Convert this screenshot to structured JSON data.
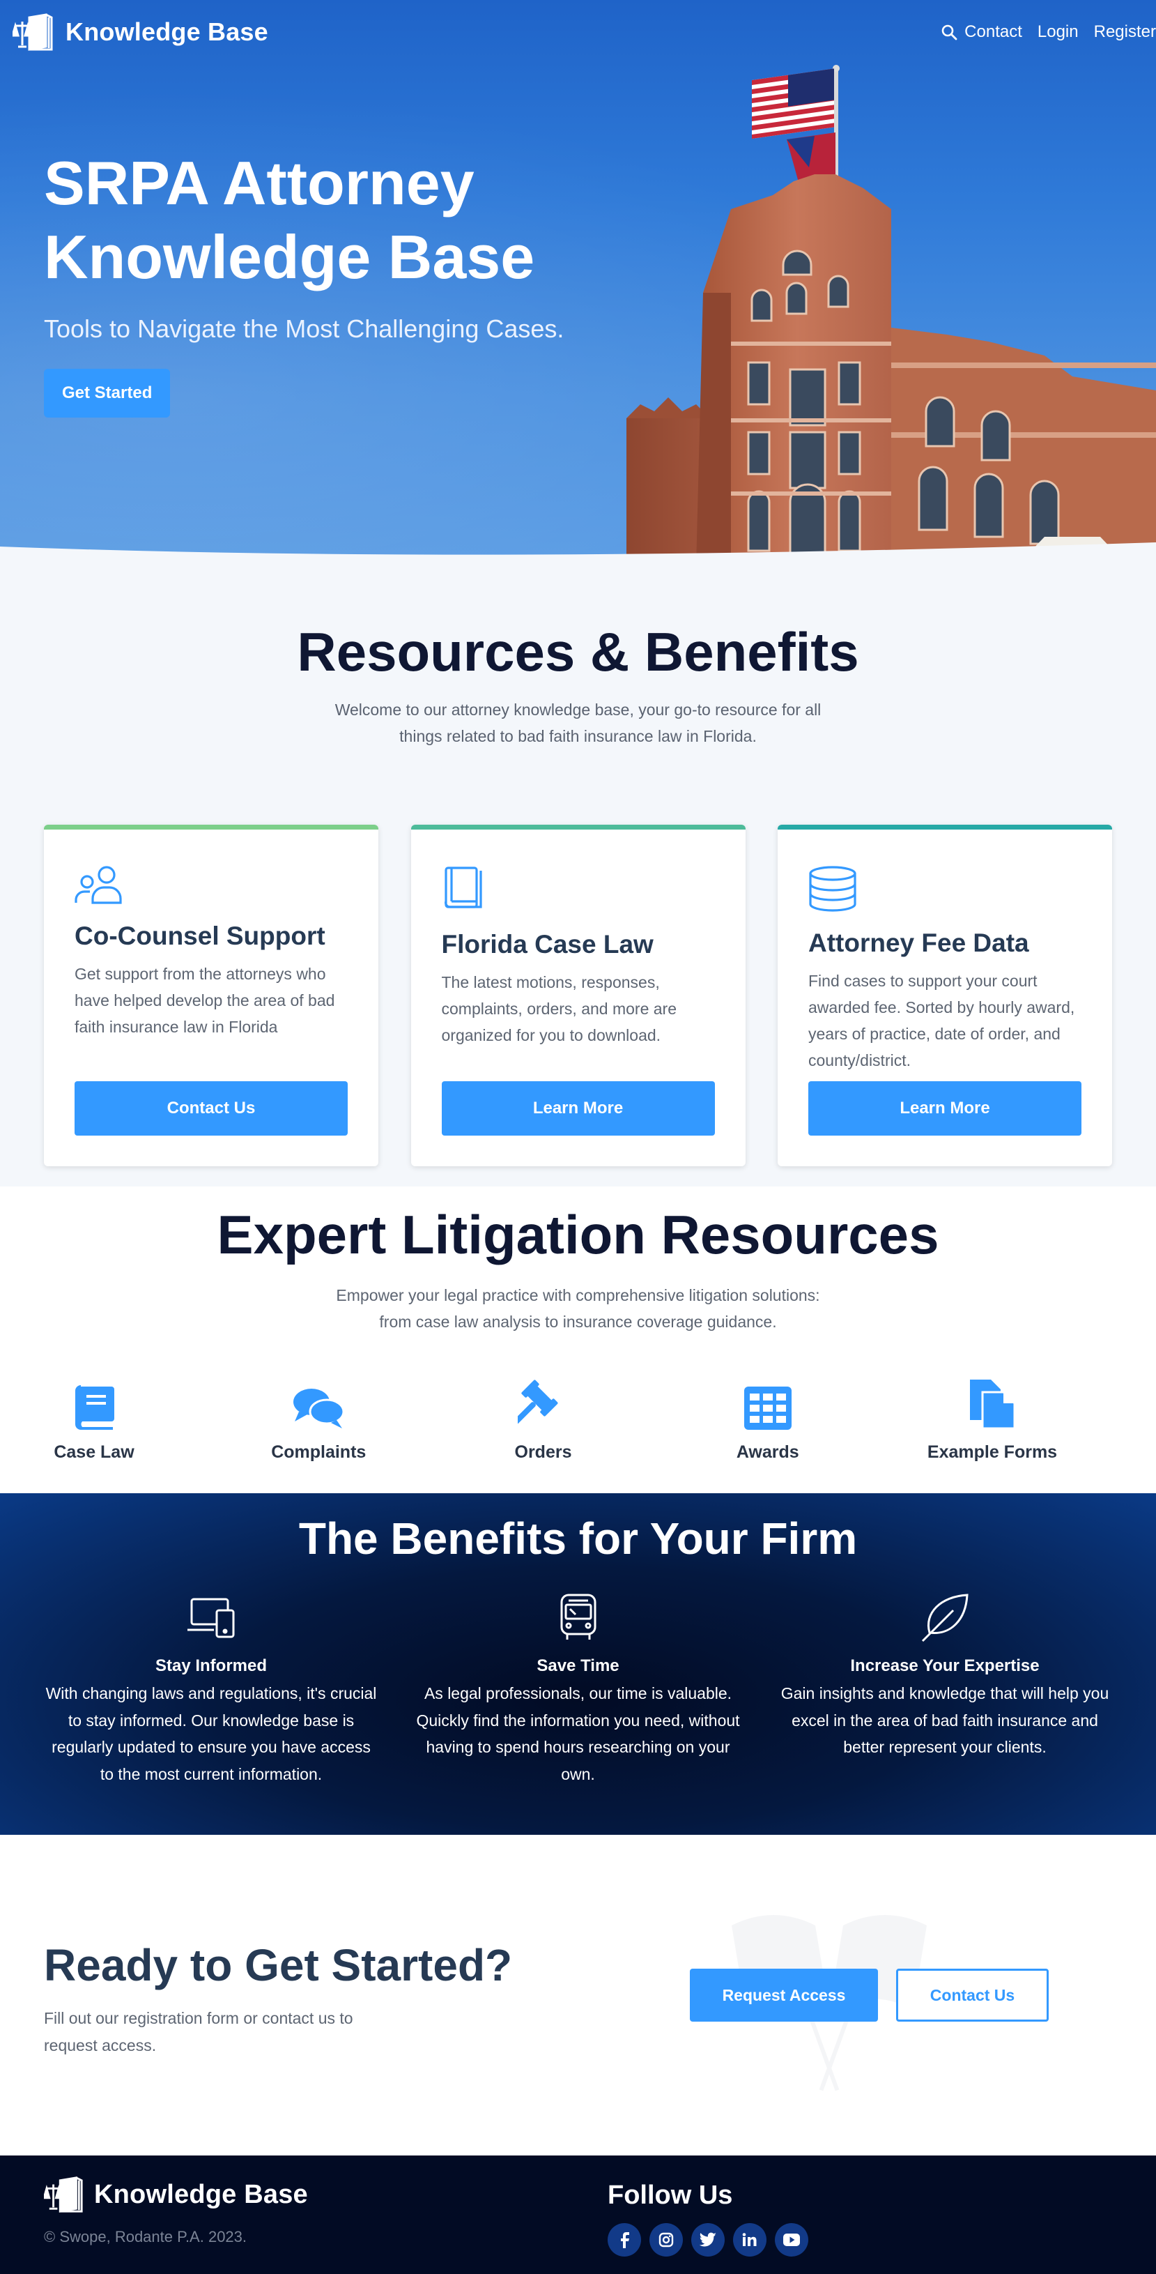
{
  "nav": {
    "brand": "Knowledge Base",
    "links": [
      "Contact",
      "Login",
      "Register"
    ]
  },
  "hero": {
    "title_line1": "SRPA Attorney",
    "title_line2": "Knowledge Base",
    "subtitle": "Tools to Navigate the Most Challenging Cases.",
    "cta": "Get Started"
  },
  "resources": {
    "title": "Resources & Benefits",
    "subtitle": "Welcome to our attorney knowledge base, your go-to resource for all things related to bad faith insurance law in Florida.",
    "cards": [
      {
        "title": "Co-Counsel Support",
        "text": "Get support from the attorneys who have helped develop the area of bad faith insurance law in Florida",
        "button": "Contact Us",
        "icon": "users-icon",
        "bar_color": "#7ccf8a"
      },
      {
        "title": "Florida Case Law",
        "text": "The latest motions, responses, complaints, orders, and more are organized for you to download.",
        "button": "Learn More",
        "icon": "book-icon",
        "bar_color": "#4dbb9a"
      },
      {
        "title": "Attorney Fee Data",
        "text": "Find cases to support your court awarded fee. Sorted by hourly award, years of practice, date of order, and county/district.",
        "button": "Learn More",
        "icon": "database-icon",
        "bar_color": "#26a9a6"
      }
    ]
  },
  "expert": {
    "title": "Expert Litigation Resources",
    "subtitle": "Empower your legal practice with comprehensive litigation solutions: from case law analysis to insurance coverage guidance.",
    "items": [
      {
        "label": "Case Law",
        "icon": "book-icon"
      },
      {
        "label": "Complaints",
        "icon": "comments-icon"
      },
      {
        "label": "Orders",
        "icon": "gavel-icon"
      },
      {
        "label": "Awards",
        "icon": "grid-icon"
      },
      {
        "label": "Example Forms",
        "icon": "documents-icon"
      }
    ]
  },
  "benefits": {
    "title": "The Benefits for Your Firm",
    "items": [
      {
        "title": "Stay Informed",
        "text": "With changing laws and regulations, it's crucial to stay informed. Our knowledge base is regularly updated to ensure you have access to the most current information.",
        "icon": "devices-icon"
      },
      {
        "title": "Save Time",
        "text": "As legal professionals, our time is valuable. Quickly find the information you need, without having to spend hours researching on your own.",
        "icon": "bus-icon"
      },
      {
        "title": "Increase Your Expertise",
        "text": "Gain insights and knowledge that will help you excel in the area of bad faith insurance and better represent your clients.",
        "icon": "leaf-icon"
      }
    ]
  },
  "cta": {
    "title": "Ready to Get Started?",
    "subtitle": "Fill out our registration form or contact us to request access.",
    "primary": "Request Access",
    "secondary": "Contact Us"
  },
  "footer": {
    "brand": "Knowledge Base",
    "copyright": "© Swope, Rodante P.A. 2023.",
    "follow_title": "Follow Us",
    "socials": [
      "facebook-icon",
      "instagram-icon",
      "twitter-icon",
      "linkedin-icon",
      "youtube-icon"
    ]
  },
  "colors": {
    "accent": "#3399ff",
    "dark_navy": "#020b24",
    "heading": "#263a54"
  }
}
